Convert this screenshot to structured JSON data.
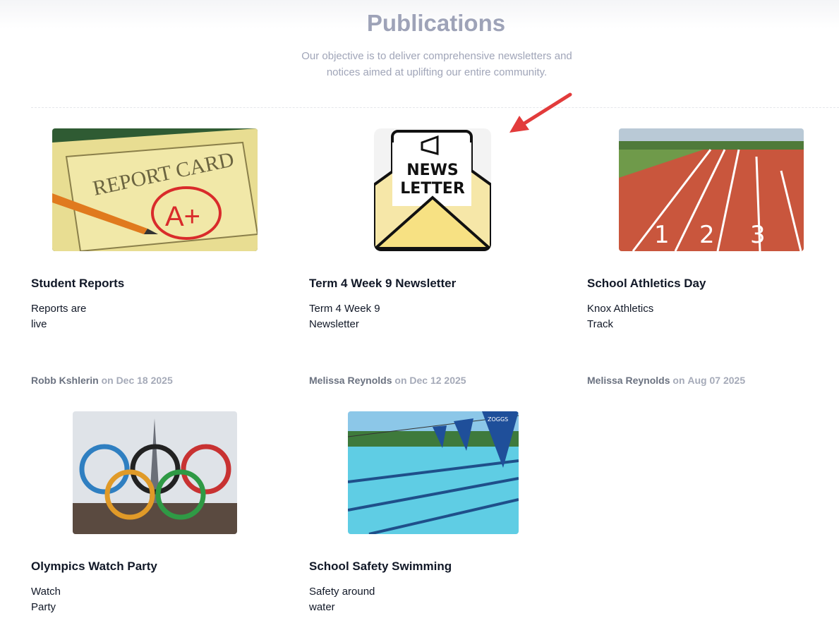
{
  "header": {
    "title": "Publications",
    "subtitle": "Our objective is to deliver comprehensive newsletters and notices aimed at uplifting our entire community."
  },
  "publications": [
    {
      "title": "Student Reports",
      "desc_line1": "Reports are",
      "desc_line2": "live",
      "author": "Robb Kshlerin",
      "on": "on",
      "date": "Dec 18 2025",
      "thumb_text": "REPORT CARD",
      "thumb_grade": "A+"
    },
    {
      "title": "Term 4 Week 9 Newsletter",
      "desc_line1": "Term 4 Week 9",
      "desc_line2": "Newsletter",
      "author": "Melissa Reynolds",
      "on": "on",
      "date": "Dec 12 2025",
      "thumb_line1": "NEWS",
      "thumb_line2": "LETTER"
    },
    {
      "title": "School Athletics Day",
      "desc_line1": "Knox Athletics",
      "desc_line2": "Track",
      "author": "Melissa Reynolds",
      "on": "on",
      "date": "Aug 07 2025",
      "thumb_lanes": [
        "1",
        "2",
        "3"
      ]
    },
    {
      "title": "Olympics Watch Party",
      "desc_line1": "Watch",
      "desc_line2": "Party"
    },
    {
      "title": "School Safety Swimming",
      "desc_line1": "Safety around",
      "desc_line2": "water",
      "thumb_flag": "ZOGGS"
    }
  ],
  "colors": {
    "accent_arrow": "#e23b3b",
    "title": "#9ea3b8",
    "track": "#c9563d",
    "pool": "#5fcde4"
  }
}
